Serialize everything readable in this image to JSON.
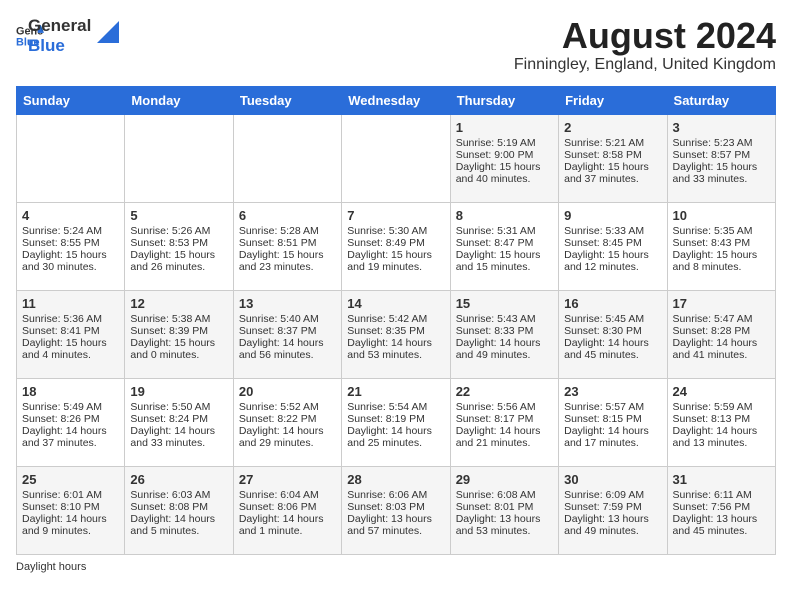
{
  "header": {
    "logo_general": "General",
    "logo_blue": "Blue",
    "month_year": "August 2024",
    "location": "Finningley, England, United Kingdom"
  },
  "days_of_week": [
    "Sunday",
    "Monday",
    "Tuesday",
    "Wednesday",
    "Thursday",
    "Friday",
    "Saturday"
  ],
  "weeks": [
    [
      {
        "day": "",
        "sunrise": "",
        "sunset": "",
        "daylight": ""
      },
      {
        "day": "",
        "sunrise": "",
        "sunset": "",
        "daylight": ""
      },
      {
        "day": "",
        "sunrise": "",
        "sunset": "",
        "daylight": ""
      },
      {
        "day": "",
        "sunrise": "",
        "sunset": "",
        "daylight": ""
      },
      {
        "day": "1",
        "sunrise": "Sunrise: 5:19 AM",
        "sunset": "Sunset: 9:00 PM",
        "daylight": "Daylight: 15 hours and 40 minutes."
      },
      {
        "day": "2",
        "sunrise": "Sunrise: 5:21 AM",
        "sunset": "Sunset: 8:58 PM",
        "daylight": "Daylight: 15 hours and 37 minutes."
      },
      {
        "day": "3",
        "sunrise": "Sunrise: 5:23 AM",
        "sunset": "Sunset: 8:57 PM",
        "daylight": "Daylight: 15 hours and 33 minutes."
      }
    ],
    [
      {
        "day": "4",
        "sunrise": "Sunrise: 5:24 AM",
        "sunset": "Sunset: 8:55 PM",
        "daylight": "Daylight: 15 hours and 30 minutes."
      },
      {
        "day": "5",
        "sunrise": "Sunrise: 5:26 AM",
        "sunset": "Sunset: 8:53 PM",
        "daylight": "Daylight: 15 hours and 26 minutes."
      },
      {
        "day": "6",
        "sunrise": "Sunrise: 5:28 AM",
        "sunset": "Sunset: 8:51 PM",
        "daylight": "Daylight: 15 hours and 23 minutes."
      },
      {
        "day": "7",
        "sunrise": "Sunrise: 5:30 AM",
        "sunset": "Sunset: 8:49 PM",
        "daylight": "Daylight: 15 hours and 19 minutes."
      },
      {
        "day": "8",
        "sunrise": "Sunrise: 5:31 AM",
        "sunset": "Sunset: 8:47 PM",
        "daylight": "Daylight: 15 hours and 15 minutes."
      },
      {
        "day": "9",
        "sunrise": "Sunrise: 5:33 AM",
        "sunset": "Sunset: 8:45 PM",
        "daylight": "Daylight: 15 hours and 12 minutes."
      },
      {
        "day": "10",
        "sunrise": "Sunrise: 5:35 AM",
        "sunset": "Sunset: 8:43 PM",
        "daylight": "Daylight: 15 hours and 8 minutes."
      }
    ],
    [
      {
        "day": "11",
        "sunrise": "Sunrise: 5:36 AM",
        "sunset": "Sunset: 8:41 PM",
        "daylight": "Daylight: 15 hours and 4 minutes."
      },
      {
        "day": "12",
        "sunrise": "Sunrise: 5:38 AM",
        "sunset": "Sunset: 8:39 PM",
        "daylight": "Daylight: 15 hours and 0 minutes."
      },
      {
        "day": "13",
        "sunrise": "Sunrise: 5:40 AM",
        "sunset": "Sunset: 8:37 PM",
        "daylight": "Daylight: 14 hours and 56 minutes."
      },
      {
        "day": "14",
        "sunrise": "Sunrise: 5:42 AM",
        "sunset": "Sunset: 8:35 PM",
        "daylight": "Daylight: 14 hours and 53 minutes."
      },
      {
        "day": "15",
        "sunrise": "Sunrise: 5:43 AM",
        "sunset": "Sunset: 8:33 PM",
        "daylight": "Daylight: 14 hours and 49 minutes."
      },
      {
        "day": "16",
        "sunrise": "Sunrise: 5:45 AM",
        "sunset": "Sunset: 8:30 PM",
        "daylight": "Daylight: 14 hours and 45 minutes."
      },
      {
        "day": "17",
        "sunrise": "Sunrise: 5:47 AM",
        "sunset": "Sunset: 8:28 PM",
        "daylight": "Daylight: 14 hours and 41 minutes."
      }
    ],
    [
      {
        "day": "18",
        "sunrise": "Sunrise: 5:49 AM",
        "sunset": "Sunset: 8:26 PM",
        "daylight": "Daylight: 14 hours and 37 minutes."
      },
      {
        "day": "19",
        "sunrise": "Sunrise: 5:50 AM",
        "sunset": "Sunset: 8:24 PM",
        "daylight": "Daylight: 14 hours and 33 minutes."
      },
      {
        "day": "20",
        "sunrise": "Sunrise: 5:52 AM",
        "sunset": "Sunset: 8:22 PM",
        "daylight": "Daylight: 14 hours and 29 minutes."
      },
      {
        "day": "21",
        "sunrise": "Sunrise: 5:54 AM",
        "sunset": "Sunset: 8:19 PM",
        "daylight": "Daylight: 14 hours and 25 minutes."
      },
      {
        "day": "22",
        "sunrise": "Sunrise: 5:56 AM",
        "sunset": "Sunset: 8:17 PM",
        "daylight": "Daylight: 14 hours and 21 minutes."
      },
      {
        "day": "23",
        "sunrise": "Sunrise: 5:57 AM",
        "sunset": "Sunset: 8:15 PM",
        "daylight": "Daylight: 14 hours and 17 minutes."
      },
      {
        "day": "24",
        "sunrise": "Sunrise: 5:59 AM",
        "sunset": "Sunset: 8:13 PM",
        "daylight": "Daylight: 14 hours and 13 minutes."
      }
    ],
    [
      {
        "day": "25",
        "sunrise": "Sunrise: 6:01 AM",
        "sunset": "Sunset: 8:10 PM",
        "daylight": "Daylight: 14 hours and 9 minutes."
      },
      {
        "day": "26",
        "sunrise": "Sunrise: 6:03 AM",
        "sunset": "Sunset: 8:08 PM",
        "daylight": "Daylight: 14 hours and 5 minutes."
      },
      {
        "day": "27",
        "sunrise": "Sunrise: 6:04 AM",
        "sunset": "Sunset: 8:06 PM",
        "daylight": "Daylight: 14 hours and 1 minute."
      },
      {
        "day": "28",
        "sunrise": "Sunrise: 6:06 AM",
        "sunset": "Sunset: 8:03 PM",
        "daylight": "Daylight: 13 hours and 57 minutes."
      },
      {
        "day": "29",
        "sunrise": "Sunrise: 6:08 AM",
        "sunset": "Sunset: 8:01 PM",
        "daylight": "Daylight: 13 hours and 53 minutes."
      },
      {
        "day": "30",
        "sunrise": "Sunrise: 6:09 AM",
        "sunset": "Sunset: 7:59 PM",
        "daylight": "Daylight: 13 hours and 49 minutes."
      },
      {
        "day": "31",
        "sunrise": "Sunrise: 6:11 AM",
        "sunset": "Sunset: 7:56 PM",
        "daylight": "Daylight: 13 hours and 45 minutes."
      }
    ]
  ],
  "footer": {
    "daylight_hours_label": "Daylight hours"
  }
}
